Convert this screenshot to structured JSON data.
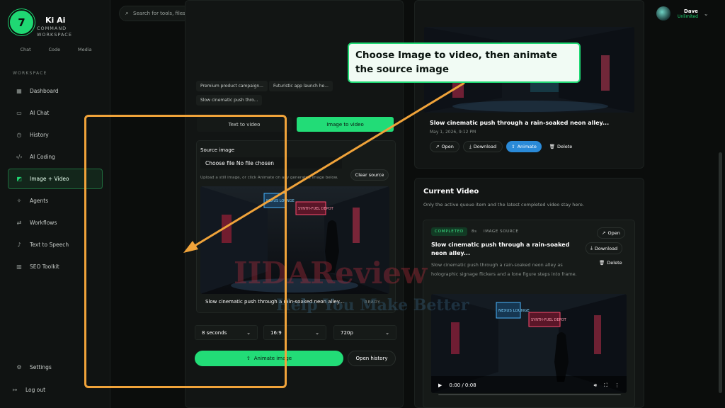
{
  "step_number": "7",
  "brand": {
    "name": "Ki Ai",
    "subtitle_line1": "COMMAND",
    "subtitle_line2": "WORKSPACE"
  },
  "mode_tabs": [
    "Chat",
    "Code",
    "Media"
  ],
  "sidebar": {
    "section_label": "WORKSPACE",
    "items": [
      {
        "label": "Dashboard",
        "icon": "grid-icon"
      },
      {
        "label": "AI Chat",
        "icon": "chat-icon"
      },
      {
        "label": "History",
        "icon": "history-icon"
      },
      {
        "label": "AI Coding",
        "icon": "code-icon"
      },
      {
        "label": "Image + Video",
        "icon": "image-icon",
        "active": true
      },
      {
        "label": "Agents",
        "icon": "agents-icon"
      },
      {
        "label": "Workflows",
        "icon": "workflow-icon"
      },
      {
        "label": "Text to Speech",
        "icon": "speech-icon"
      },
      {
        "label": "SEO Toolkit",
        "icon": "chart-icon"
      }
    ],
    "settings": "Settings",
    "logout": "Log out"
  },
  "search": {
    "placeholder": "Search for tools, files, or prc"
  },
  "user": {
    "name": "Dave",
    "plan": "Unlimited"
  },
  "prompt_chips": [
    "Premium product campaign...",
    "Futuristic app launch he...",
    "Slow cinematic push thro..."
  ],
  "mode_toggle": {
    "text_to_video": "Text to video",
    "image_to_video": "Image to video"
  },
  "source": {
    "title": "Source image",
    "file_label": "Choose file No file chosen",
    "help": "Upload a still image, or click Animate on any generated image below.",
    "clear": "Clear source",
    "image_sign_1": "NEXUS LOUNGE",
    "image_sign_2": "SYNTH-FUEL DEPOT",
    "caption": "Slow cinematic push through a rain-soaked neon alley...",
    "status": "READY"
  },
  "options": {
    "duration": "8 seconds",
    "aspect": "16:9",
    "resolution": "720p"
  },
  "buttons": {
    "animate": "Animate image",
    "open_history": "Open history"
  },
  "queue_item": {
    "title": "Slow cinematic push through a rain-soaked neon alley...",
    "date": "May 1, 2026, 9:12 PM",
    "actions": [
      "Open",
      "Download",
      "Animate",
      "Delete"
    ]
  },
  "current_video": {
    "title": "Current Video",
    "subtitle": "Only the active queue item and the latest completed video stay here.",
    "badge": "COMPLETED",
    "duration": "8s",
    "source_tag": "IMAGE SOURCE",
    "clip_title": "Slow cinematic push through a rain-soaked neon alley...",
    "description": "Slow cinematic push through a rain-soaked neon alley as holographic signage flickers and a lone figure steps into frame.",
    "actions": [
      "Open",
      "Download",
      "Delete"
    ],
    "time": "0:00 / 0:08",
    "progress": 0.0
  },
  "callout": {
    "text": "Choose Image to video, then animate the source image"
  },
  "watermark": {
    "line1": "IIDAReview",
    "line2": "Help You Make Better"
  },
  "colors": {
    "accent": "#22dc77",
    "highlight": "#f0a33a",
    "animate_btn": "#2a8ad8"
  }
}
